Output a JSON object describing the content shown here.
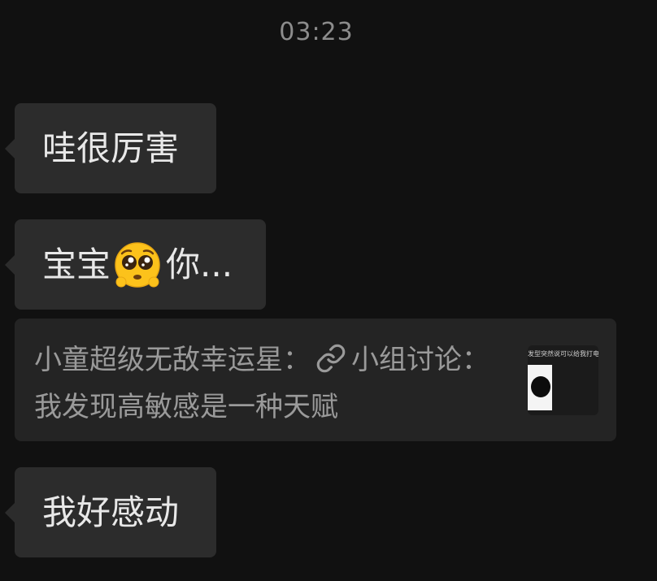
{
  "chat": {
    "timestamp": "03:23",
    "messages": [
      {
        "text": "哇很厉害"
      },
      {
        "text_before": "宝宝",
        "emoji": "pleading-face-emoji",
        "text_after": "你..."
      },
      {
        "quote": {
          "sender_prefix": "小童超级无敌幸运星：",
          "link_icon": "link-icon",
          "title": "小组讨论：我发现高敏感是一种天赋",
          "thumbnail_caption": "发型突然说可以给我打电话"
        }
      },
      {
        "text": "我好感动"
      }
    ]
  },
  "colors": {
    "background": "#111111",
    "bubble": "#2c2c2c",
    "quote_card": "#242424",
    "text": "#e8e8e8",
    "muted_text": "#9a9a9a"
  }
}
